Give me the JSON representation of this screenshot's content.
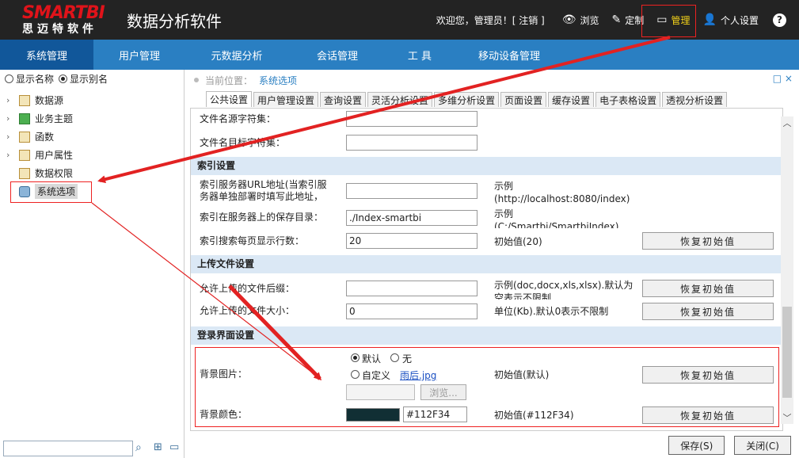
{
  "header": {
    "logo_main": "SMARTBI",
    "logo_sub": "思迈特软件",
    "title": "数据分析软件",
    "welcome": "欢迎您，管理员！[ 注销 ]",
    "browse": "浏览",
    "custom": "定制",
    "manage": "管理",
    "personal": "个人设置",
    "help": "?"
  },
  "nav": {
    "items": [
      "系统管理",
      "用户管理",
      "元数据分析",
      "会话管理",
      "工 具",
      "移动设备管理"
    ]
  },
  "left": {
    "radio_name": "显示名称",
    "radio_alias": "显示别名",
    "tree": [
      "数据源",
      "业务主题",
      "函数",
      "用户属性",
      "数据权限",
      "系统选项"
    ]
  },
  "right": {
    "breadcrumb_label": "当前位置：",
    "breadcrumb_current": "系统选项",
    "win_ctrl": "□ ×",
    "tabs": [
      "公共设置",
      "用户管理设置",
      "查询设置",
      "灵活分析设置",
      "多维分析设置",
      "页面设置",
      "缓存设置",
      "电子表格设置",
      "透视分析设置"
    ]
  },
  "form": {
    "file_charset_label": "文件名源字符集：",
    "file_target_charset_label": "文件名目标字符集：",
    "index_section": "索引设置",
    "index_url_label": "索引服务器URL地址(当索引服务器单独部署时填写此地址，",
    "index_url_hint": "示例(http://localhost:8080/index)",
    "index_dir_label": "索引在服务器上的保存目录：",
    "index_dir_value": "./Index-smartbi",
    "index_dir_hint": "示例(C:/Smartbi/SmartbiIndex)",
    "index_rows_label": "索引搜索每页显示行数：",
    "index_rows_value": "20",
    "index_rows_hint": "初始值(20)",
    "upload_section": "上传文件设置",
    "upload_ext_label": "允许上传的文件后缀：",
    "upload_ext_hint": "示例(doc,docx,xls,xlsx).默认为空表示不限制",
    "upload_size_label": "允许上传的文件大小：",
    "upload_size_value": "0",
    "upload_size_hint": "单位(Kb).默认0表示不限制",
    "login_section": "登录界面设置",
    "bg_image_label": "背景图片：",
    "bg_default": "默认",
    "bg_none": "无",
    "bg_custom": "自定义",
    "bg_file": "雨后.jpg",
    "bg_browse": "浏览...",
    "bg_image_hint": "初始值(默认)",
    "bg_color_label": "背景颜色：",
    "bg_color_value": "#112F34",
    "bg_color_hint": "初始值(#112F34)",
    "reset_label": "恢复初始值"
  },
  "buttons": {
    "save": "保存(S)",
    "close": "关闭(C)"
  },
  "colors": {
    "header_bg": "#232323",
    "nav_bg": "#2a7fc2",
    "nav_active": "#11579a",
    "swatch": "#112F34",
    "annotation": "#e22222"
  }
}
